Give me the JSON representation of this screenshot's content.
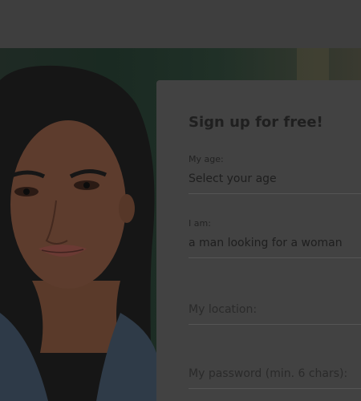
{
  "signup": {
    "title": "Sign up for free!",
    "age": {
      "label": "My age:",
      "value": "Select your age"
    },
    "gender": {
      "label": "I am:",
      "value": "a man looking for a woman"
    },
    "location": {
      "placeholder": "My location:"
    },
    "password": {
      "placeholder": "My password (min. 6 chars):"
    }
  }
}
